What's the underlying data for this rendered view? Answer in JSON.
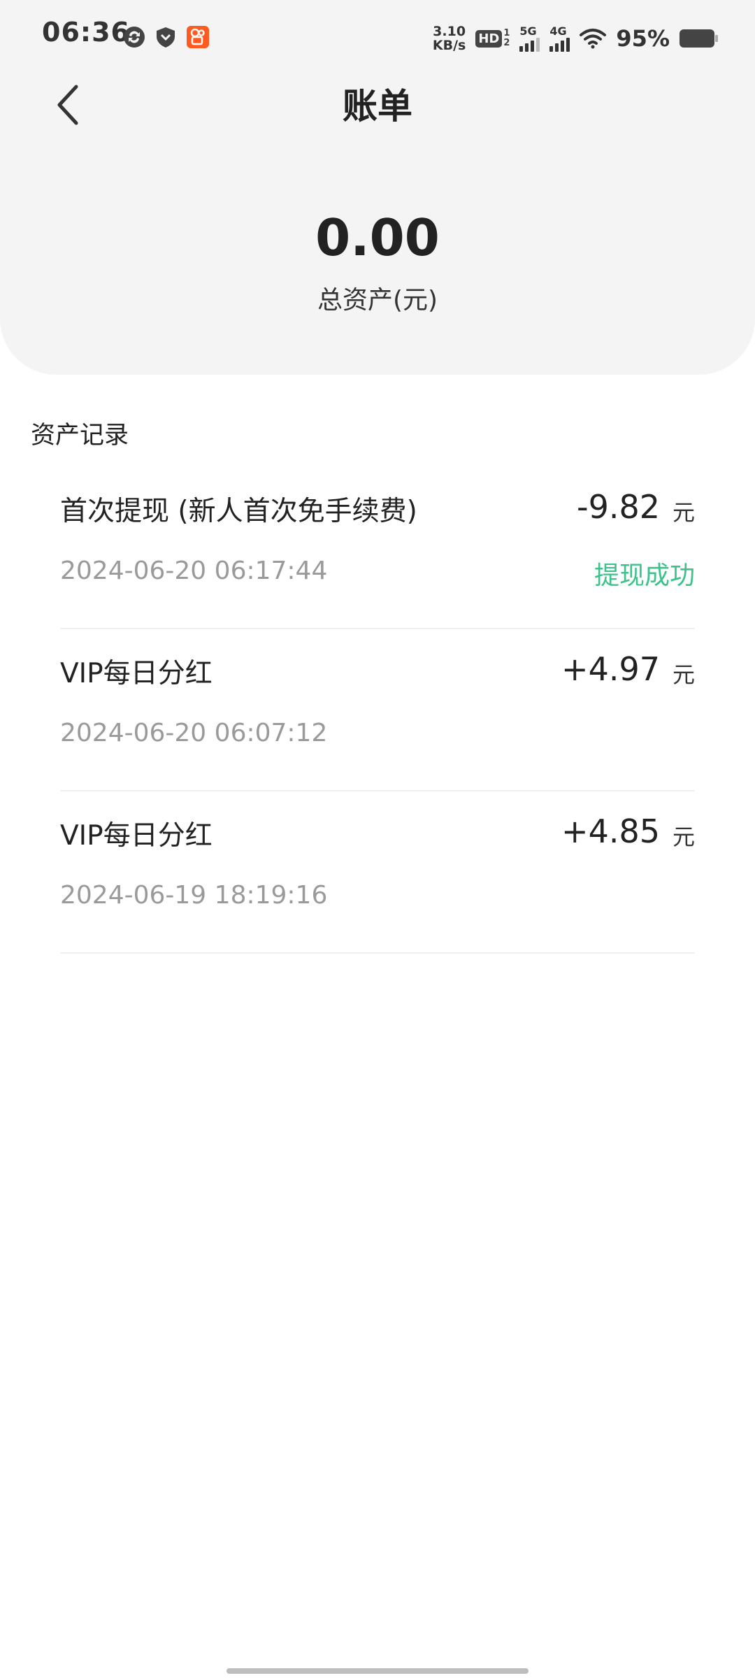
{
  "status_bar": {
    "time": "06:36",
    "net_speed_value": "3.10",
    "net_speed_unit": "KB/s",
    "hd_label": "HD",
    "hd_sub_top": "1",
    "hd_sub_bottom": "2",
    "sig1_label": "5G",
    "sig2_label": "4G",
    "battery": "95%",
    "icons": [
      "sync-icon",
      "shield-icon",
      "kuaishou-app-icon",
      "wifi-icon",
      "battery-icon"
    ]
  },
  "nav": {
    "title": "账单",
    "back_icon": "chevron-left-icon"
  },
  "summary": {
    "total_value": "0.00",
    "total_label": "总资产(元)"
  },
  "section": {
    "title": "资产记录"
  },
  "records": [
    {
      "title": "首次提现 (新人首次免手续费)",
      "amount": "-9.82",
      "unit": "元",
      "time": "2024-06-20 06:17:44",
      "status": "提现成功"
    },
    {
      "title": "VIP每日分红",
      "amount": "+4.97",
      "unit": "元",
      "time": "2024-06-20 06:07:12",
      "status": ""
    },
    {
      "title": "VIP每日分红",
      "amount": "+4.85",
      "unit": "元",
      "time": "2024-06-19 18:19:16",
      "status": ""
    }
  ],
  "colors": {
    "header_bg": "#f4f4f4",
    "status_success": "#3cc28a",
    "secondary_text": "#9a9a9a"
  }
}
